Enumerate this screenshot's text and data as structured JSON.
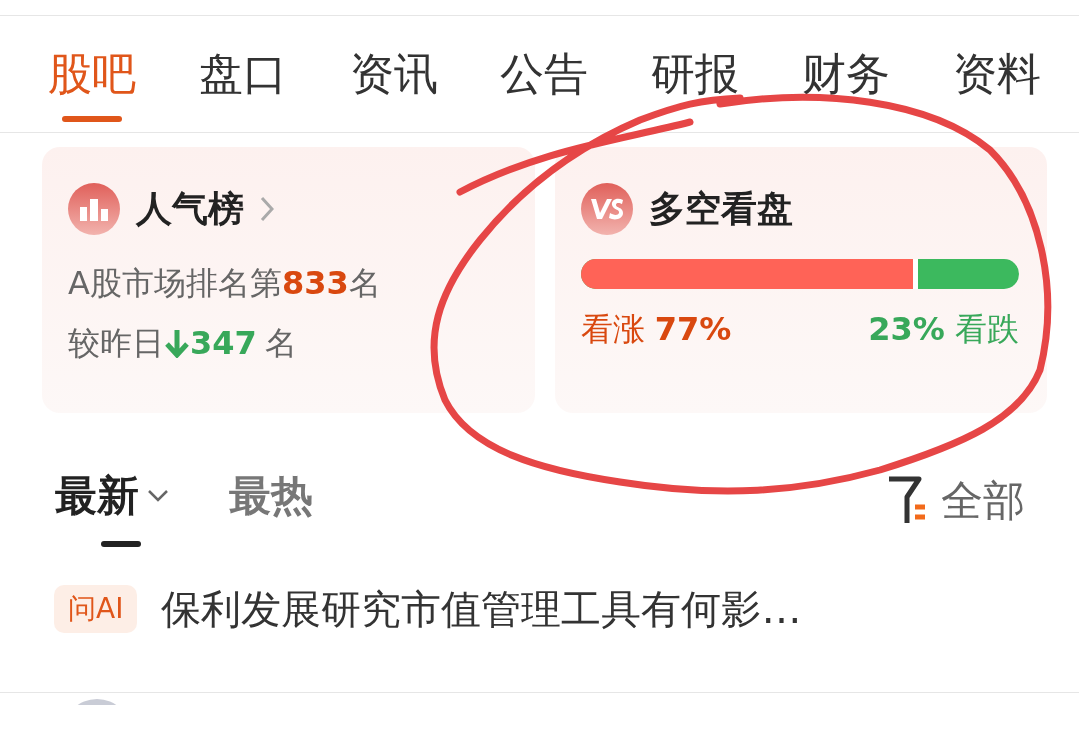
{
  "tabs": [
    {
      "label": "股吧",
      "selected": true
    },
    {
      "label": "盘口",
      "selected": false
    },
    {
      "label": "资讯",
      "selected": false
    },
    {
      "label": "公告",
      "selected": false
    },
    {
      "label": "研报",
      "selected": false
    },
    {
      "label": "财务",
      "selected": false
    },
    {
      "label": "资料",
      "selected": false
    }
  ],
  "ranking_card": {
    "title": "人气榜",
    "rank_prefix": "A股市场排名第",
    "rank": "833",
    "rank_suffix": "名",
    "change_prefix": "较昨日",
    "rank_fell": true,
    "change": "347",
    "change_suffix": "名"
  },
  "sentiment_card": {
    "title": "多空看盘",
    "level": 0.77,
    "bull_label": "看涨",
    "bull_percent": "77%",
    "bear_percent": "23%",
    "bear_label": "看跌"
  },
  "sort_tabs": [
    {
      "label": "最新",
      "selected": true,
      "dropdown": true
    },
    {
      "label": "最热",
      "selected": false,
      "dropdown": false
    }
  ],
  "filter": {
    "label": "全部"
  },
  "posts": [
    {
      "badge": "问AI",
      "title": "保利发展研究市值管理工具有何影…"
    }
  ]
}
